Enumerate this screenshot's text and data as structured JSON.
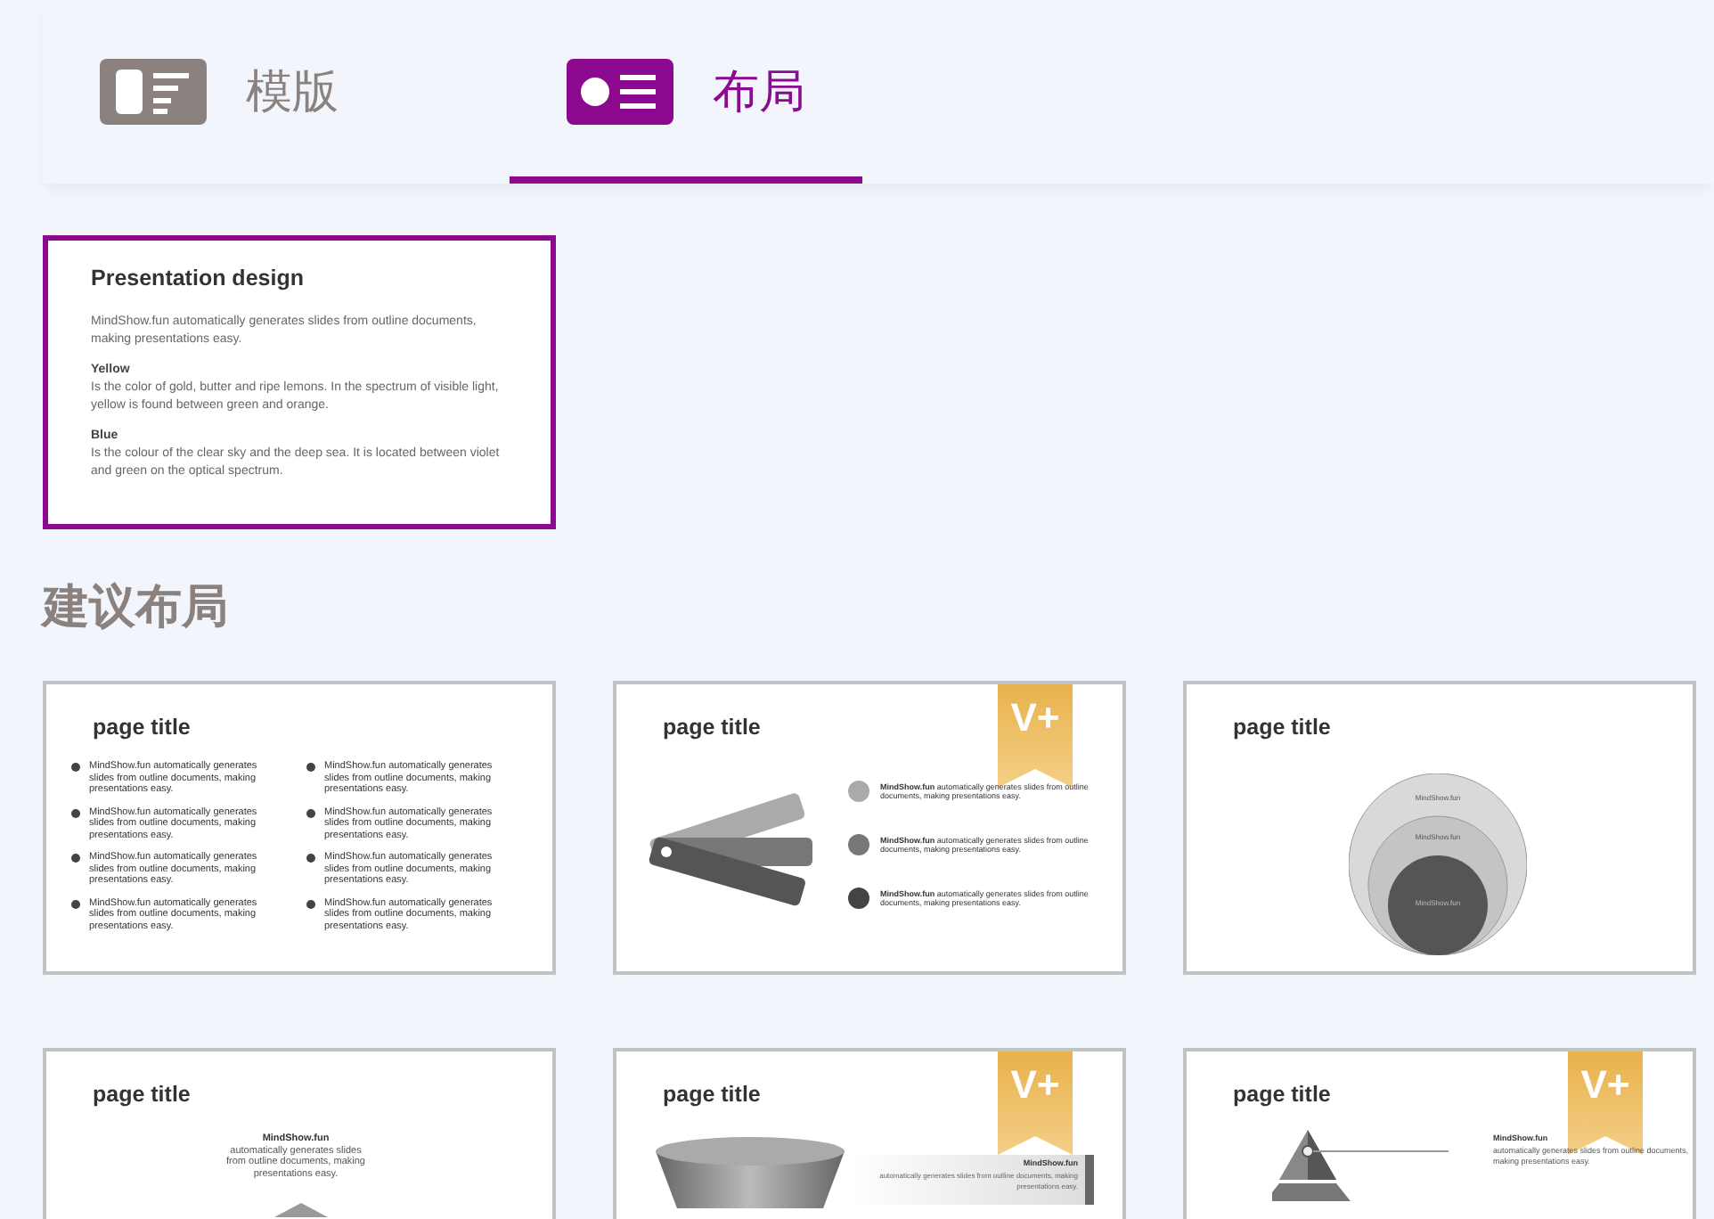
{
  "tabs": [
    {
      "label": "模版",
      "selected": false
    },
    {
      "label": "布局",
      "selected": true
    }
  ],
  "current_layout": {
    "title": "Presentation design",
    "selected": true,
    "paragraphs": [
      {
        "text": "MindShow.fun automatically generates slides from outline documents, making presentations easy."
      },
      {
        "heading": "Yellow",
        "text": "Is the color of gold, butter and ripe lemons. In the spectrum of visible light, yellow is found between green and orange."
      },
      {
        "heading": "Blue",
        "text": "Is the colour of the clear sky and the deep sea. It is located between violet and green on the optical spectrum."
      }
    ]
  },
  "section_title": "建议布局",
  "layouts": [
    {
      "kind": "bullets",
      "title": "page title",
      "columns": [
        [
          "MindShow.fun automatically generates slides from outline documents, making presentations easy.",
          "MindShow.fun automatically generates slides from outline documents, making presentations easy.",
          "MindShow.fun automatically generates slides from outline documents, making presentations easy.",
          "MindShow.fun automatically generates slides from outline documents, making presentations easy."
        ],
        [
          "MindShow.fun automatically generates slides from outline documents, making presentations easy.",
          "MindShow.fun automatically generates slides from outline documents, making presentations easy.",
          "MindShow.fun automatically generates slides from outline documents, making presentations easy.",
          "MindShow.fun automatically generates slides from outline documents, making presentations easy."
        ]
      ]
    },
    {
      "kind": "swatches",
      "title": "page title",
      "badge": "V+",
      "items": [
        "**MindShow.fun** automatically generates slides from outline documents, making presentations easy.",
        "**MindShow.fun** automatically generates slides from outline documents, making presentations easy.",
        "**MindShow.fun** automatically generates slides from outline documents, making presentations easy."
      ]
    },
    {
      "kind": "circles",
      "title": "page title",
      "labels": [
        "MindShow.fun",
        "MindShow.fun",
        "MindShow.fun"
      ]
    },
    {
      "kind": "caption",
      "title": "page title",
      "heading": "MindShow.fun",
      "text": "automatically generates slides from outline documents, making presentations easy."
    },
    {
      "kind": "bowl",
      "title": "page title",
      "badge": "V+",
      "heading": "MindShow.fun",
      "text": "automatically generates slides from outline documents, making presentations easy."
    },
    {
      "kind": "pyramid",
      "title": "page title",
      "badge": "V+",
      "heading": "MindShow.fun",
      "text": "automatically generates slides from outline documents, making presentations easy."
    }
  ]
}
